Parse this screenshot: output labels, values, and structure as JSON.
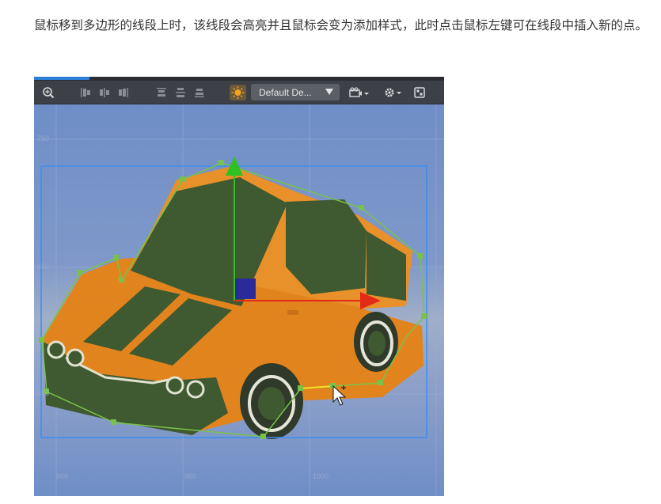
{
  "article": {
    "paragraph": "鼠标移到多边形的线段上时，该线段会高亮并且鼠标会变为添加样式，此时点击鼠标左键可在线段中插入新的点。"
  },
  "toolbar": {
    "camera_dropdown_value": "Default De...",
    "icons": [
      "zoom-icon",
      "align-icons",
      "distribute-icons",
      "light-icon",
      "camera-icon",
      "gear-icon",
      "layout-icon"
    ]
  },
  "scene": {
    "grid_labels": {
      "left_top": "750",
      "left_mid": "650",
      "left_low": "550",
      "bottom_1": "900",
      "bottom_2": "950",
      "bottom_3": "1000"
    }
  },
  "colors": {
    "bounding_box": "#3a8ef0",
    "polygon": "#79c24a",
    "gizmo_x": "#e22a16",
    "gizmo_y": "#2fc021",
    "gizmo_center": "#2a2a9a",
    "car_body": "#e2841e",
    "car_glass": "#3f5930",
    "highlight_segment": "#f0e22a"
  }
}
